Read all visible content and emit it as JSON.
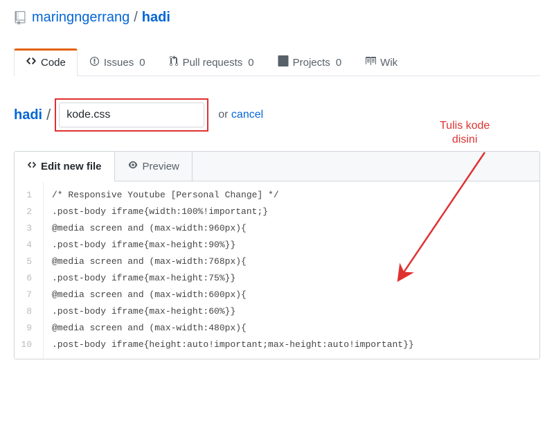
{
  "breadcrumb": {
    "owner": "maringngerrang",
    "sep": "/",
    "repo": "hadi"
  },
  "tabs": {
    "code": {
      "label": "Code"
    },
    "issues": {
      "label": "Issues",
      "count": "0"
    },
    "pulls": {
      "label": "Pull requests",
      "count": "0"
    },
    "projects": {
      "label": "Projects",
      "count": "0"
    },
    "wiki": {
      "label": "Wik"
    }
  },
  "file": {
    "root": "hadi",
    "slash": "/",
    "name_value": "kode.css",
    "or_text": "or ",
    "cancel": "cancel"
  },
  "editor": {
    "edit_tab": "Edit new file",
    "preview_tab": "Preview",
    "line_numbers": [
      "1",
      "2",
      "3",
      "4",
      "5",
      "6",
      "7",
      "8",
      "9",
      "10"
    ],
    "lines": [
      "/* Responsive Youtube [Personal Change] */",
      ".post-body iframe{width:100%!important;}",
      "@media screen and (max-width:960px){",
      ".post-body iframe{max-height:90%}}",
      "@media screen and (max-width:768px){",
      ".post-body iframe{max-height:75%}}",
      "@media screen and (max-width:600px){",
      ".post-body iframe{max-height:60%}}",
      "@media screen and (max-width:480px){",
      ".post-body iframe{height:auto!important;max-height:auto!important}}"
    ]
  },
  "annotation": {
    "text": "Tulis kode\ndisini"
  }
}
